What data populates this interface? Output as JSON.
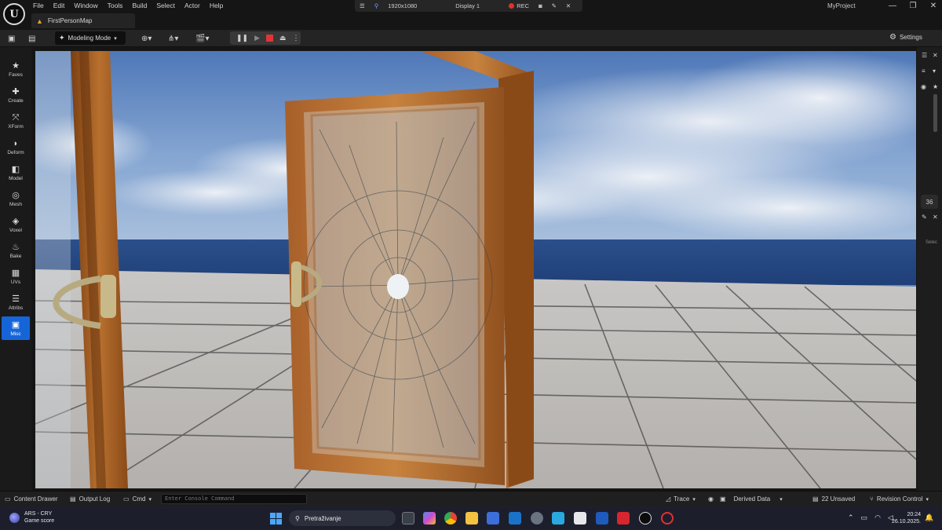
{
  "app": {
    "menu": [
      "File",
      "Edit",
      "Window",
      "Tools",
      "Build",
      "Select",
      "Actor",
      "Help"
    ],
    "map_tab": "FirstPersonMap",
    "project_name": "MyProject"
  },
  "recording_bar": {
    "resolution": "1920x1080",
    "display": "Display 1",
    "rec_label": "REC"
  },
  "toolbar": {
    "mode_label": "Modeling Mode",
    "settings_label": "Settings"
  },
  "palette": {
    "items": [
      {
        "label": "Faves",
        "glyph": "★"
      },
      {
        "label": "Create",
        "glyph": "✚"
      },
      {
        "label": "XForm",
        "glyph": "⤧"
      },
      {
        "label": "Deform",
        "glyph": "◗"
      },
      {
        "label": "Model",
        "glyph": "◧"
      },
      {
        "label": "Mesh",
        "glyph": "◎"
      },
      {
        "label": "Voxel",
        "glyph": "◈"
      },
      {
        "label": "Bake",
        "glyph": "♨"
      },
      {
        "label": "UVs",
        "glyph": "▦"
      },
      {
        "label": "Attribs",
        "glyph": "☰"
      },
      {
        "label": "Misc",
        "glyph": "▣"
      }
    ],
    "active": "Misc"
  },
  "right_panel": {
    "number": "36",
    "select_label": "Selec"
  },
  "statusbar": {
    "content_drawer": "Content Drawer",
    "output_log": "Output Log",
    "cmd": "Cmd",
    "console_placeholder": "Enter Console Command",
    "trace": "Trace",
    "derived_data": "Derived Data",
    "unsaved": "22 Unsaved",
    "revision_control": "Revision Control"
  },
  "taskbar": {
    "weather_title": "ARS - CRY",
    "weather_subtitle": "Game score",
    "search_placeholder": "Pretraživanje",
    "time": "20:24",
    "date": "26.10.2025."
  },
  "colors": {
    "accent": "#1565d8",
    "rec": "#e03030",
    "stop": "#e03535"
  }
}
